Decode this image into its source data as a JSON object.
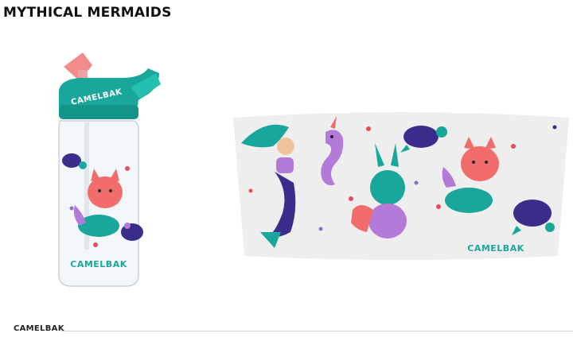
{
  "page": {
    "title": "MYTHICAL MERMAIDS"
  },
  "bottle": {
    "brand": "CAMELBAK"
  },
  "wrap": {
    "brand": "CAMELBAK"
  },
  "footer": {
    "brand": "CAMELBAK"
  },
  "colors": {
    "teal": "#1aa79b",
    "coral": "#f26c6c",
    "pink_straw": "#f28b8b",
    "navy": "#3a2d8c",
    "lavender": "#b37ad8",
    "hearts_red": "#e94b5a",
    "hearts_purple": "#8a6fd6"
  }
}
